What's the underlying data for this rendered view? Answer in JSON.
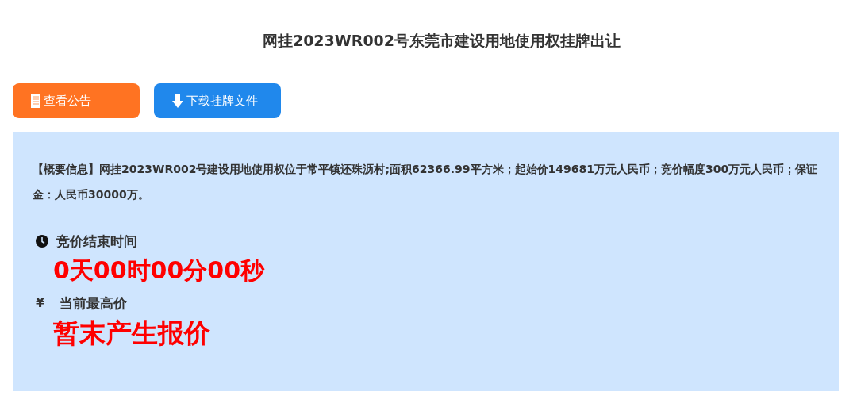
{
  "title": "网挂2023WR002号东莞市建设用地使用权挂牌出让",
  "buttons": [
    {
      "label": "查看公告",
      "color": "#ff7322"
    },
    {
      "label": "下载挂牌文件",
      "color": "#2088ec"
    }
  ],
  "summary": "【概要信息】网挂2023WR002号建设用地使用权位于常平镇还珠沥村;面积62366.99平方米；起始价149681万元人民币；竞价幅度300万元人民币；保证金：人民币30000万。",
  "sections": [
    {
      "kind": "countdown",
      "label": "竞价结束时间",
      "value": "0天00时00分00秒"
    },
    {
      "kind": "price",
      "symbol": "¥",
      "label": "当前最高价",
      "value": "暂末产生报价"
    }
  ]
}
